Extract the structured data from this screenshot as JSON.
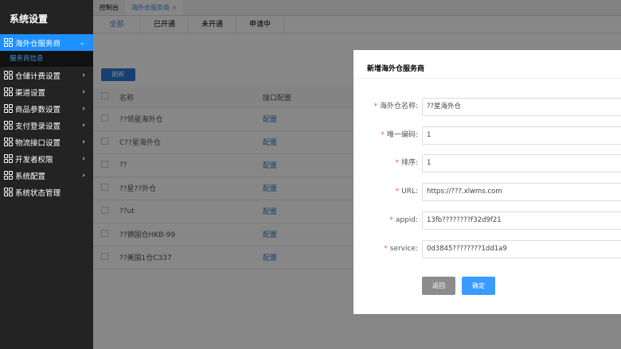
{
  "sidebar": {
    "title": "系统设置",
    "items": [
      {
        "label": "海外仓服务商",
        "icon": "grid-icon",
        "active": true,
        "sub": [
          "服务商信息"
        ]
      },
      {
        "label": "仓储计费设置"
      },
      {
        "label": "渠道设置"
      },
      {
        "label": "商品参数设置"
      },
      {
        "label": "支付登录设置"
      },
      {
        "label": "物流接口设置"
      },
      {
        "label": "开发者权限"
      },
      {
        "label": "系统配置"
      },
      {
        "label": "系统状态管理"
      }
    ]
  },
  "tabs": [
    "控制台",
    "海外仓服务商"
  ],
  "subtabs": [
    "全部",
    "已开通",
    "未开通",
    "申请中"
  ],
  "refresh": "刷新",
  "table": {
    "headers": [
      "名称",
      "接口配置"
    ],
    "rows": [
      [
        "??领星海外仓",
        "配置"
      ],
      [
        "C??星海外仓",
        "配置"
      ],
      [
        "??",
        "配置"
      ],
      [
        "??星??外仓",
        "配置"
      ],
      [
        "??ut",
        "配置"
      ],
      [
        "??德国仓HKB-99",
        "配置"
      ],
      [
        "??美国1仓C337",
        "配置"
      ]
    ]
  },
  "modal": {
    "title": "新增海外仓服务商",
    "fields": [
      {
        "label": "海外仓名称:",
        "value": "??星海外仓"
      },
      {
        "label": "唯一编码:",
        "value": "1"
      },
      {
        "label": "排序:",
        "value": "1"
      },
      {
        "label": "URL:",
        "value": "https://???.xlwms.com"
      },
      {
        "label": "appid:",
        "value": "13fb????????f32d9f21"
      },
      {
        "label": "service:",
        "value": "0d3845????????1dd1a9"
      }
    ],
    "back": "返回",
    "confirm": "确定"
  }
}
